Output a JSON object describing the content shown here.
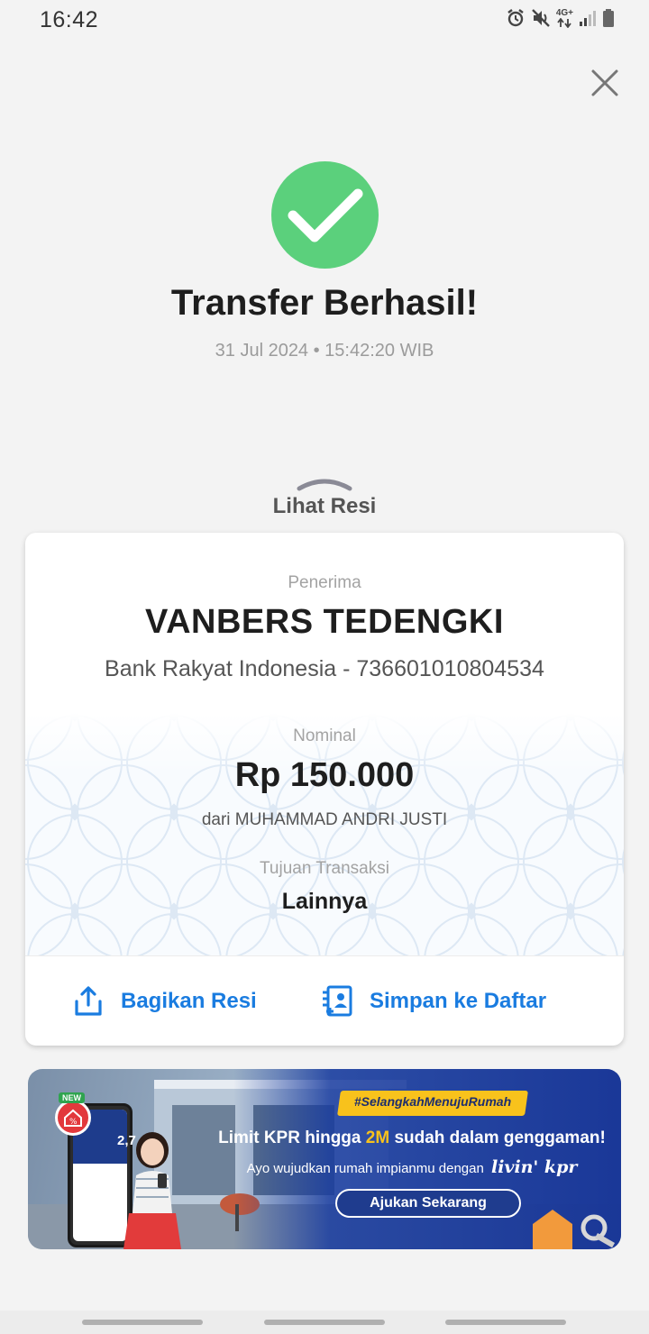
{
  "status_bar": {
    "time": "16:42",
    "network": "4G+"
  },
  "header": {
    "title": "Transfer Berhasil!",
    "timestamp": "31 Jul 2024 • 15:42:20 WIB"
  },
  "receipt": {
    "toggle_label": "Lihat Resi",
    "recipient_label": "Penerima",
    "recipient_name": "VANBERS TEDENGKI",
    "recipient_bank": "Bank Rakyat Indonesia - 736601010804534",
    "amount_label": "Nominal",
    "amount": "Rp 150.000",
    "sender": "dari MUHAMMAD ANDRI JUSTI",
    "purpose_label": "Tujuan Transaksi",
    "purpose": "Lainnya",
    "share_label": "Bagikan Resi",
    "save_label": "Simpan ke Daftar"
  },
  "banner": {
    "hashtag": "#SelangkahMenujuRumah",
    "headline_prefix": "Limit KPR hingga ",
    "headline_highlight": "2M",
    "headline_suffix": " sudah dalam genggaman!",
    "sub": "Ayo wujudkan rumah impianmu dengan",
    "brand": "livin' kpr",
    "cta": "Ajukan Sekarang",
    "phone_rate": "2,7",
    "new_badge": "NEW"
  },
  "colors": {
    "success": "#5bd07c",
    "accent": "#1a7ce0",
    "banner_blue": "#1f3c8e",
    "banner_yellow": "#f8c21c"
  }
}
